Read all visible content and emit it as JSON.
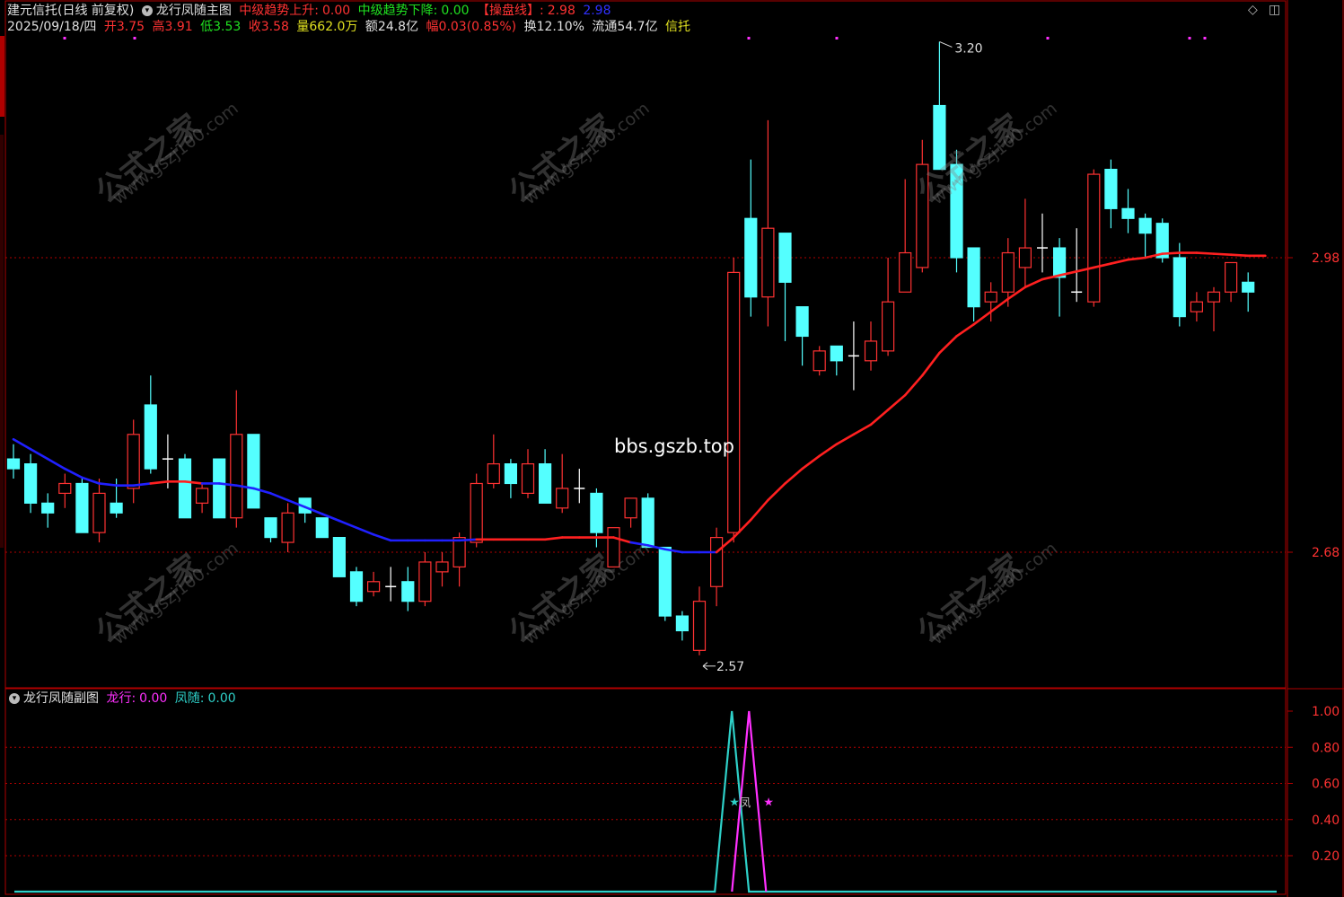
{
  "header": {
    "stock_name": "建元信托",
    "mode": "(日线 前复权)",
    "indicator_name": "龙行凤随主图",
    "up_label": "中级趋势上升",
    "up_value": "0.00",
    "down_label": "中级趋势下降",
    "down_value": "0.00",
    "op_label": "【操盘线】",
    "op_value": "2.98",
    "op_value2": "2.98"
  },
  "quote": {
    "date": "2025/09/18/四",
    "open_label": "开",
    "open": "3.75",
    "high_label": "高",
    "high": "3.91",
    "low_label": "低",
    "low": "3.53",
    "close_label": "收",
    "close": "3.58",
    "vol_label": "量",
    "vol": "662.0万",
    "amt_label": "额",
    "amt": "24.8亿",
    "chg_label": "幅",
    "chg": "0.03(0.85%)",
    "turn_label": "换",
    "turn": "12.10%",
    "float_label": "流通",
    "float": "54.7亿",
    "sector": "信托"
  },
  "sub": {
    "name": "龙行凤随副图",
    "long_label": "龙行",
    "long_value": "0.00",
    "feng_label": "凤随",
    "feng_value": "0.00",
    "marker_text": "凤"
  },
  "watermark": {
    "text": "公式之家",
    "url": "www.gszj100.com"
  },
  "overlay_text": "bbs.gszb.top",
  "annotations": {
    "high": "3.20",
    "low": "2.57"
  },
  "colors": {
    "up": "#ff3232",
    "down": "#54ffff",
    "doji": "#ffffff",
    "ma_up": "#ff2020",
    "ma_down": "#2020ff",
    "frame": "#b00000",
    "long_line": "#ff30ff",
    "feng_line": "#2ed0c8"
  },
  "chart_data": [
    {
      "type": "candlestick",
      "price_ticks": [
        2.68,
        2.98
      ],
      "ylim": [
        2.54,
        3.22
      ],
      "candles": [
        {
          "o": 2.775,
          "c": 2.765,
          "h": 2.79,
          "l": 2.755
        },
        {
          "o": 2.77,
          "c": 2.73,
          "h": 2.78,
          "l": 2.72
        },
        {
          "o": 2.73,
          "c": 2.72,
          "h": 2.74,
          "l": 2.705
        },
        {
          "o": 2.74,
          "c": 2.75,
          "h": 2.76,
          "l": 2.725
        },
        {
          "o": 2.75,
          "c": 2.7,
          "h": 2.755,
          "l": 2.7
        },
        {
          "o": 2.7,
          "c": 2.74,
          "h": 2.755,
          "l": 2.69
        },
        {
          "o": 2.73,
          "c": 2.72,
          "h": 2.755,
          "l": 2.715
        },
        {
          "o": 2.745,
          "c": 2.8,
          "h": 2.815,
          "l": 2.73
        },
        {
          "o": 2.83,
          "c": 2.765,
          "h": 2.86,
          "l": 2.76
        },
        {
          "o": 2.775,
          "c": 2.775,
          "h": 2.8,
          "l": 2.745
        },
        {
          "o": 2.775,
          "c": 2.715,
          "h": 2.78,
          "l": 2.715
        },
        {
          "o": 2.73,
          "c": 2.745,
          "h": 2.75,
          "l": 2.72
        },
        {
          "o": 2.775,
          "c": 2.715,
          "h": 2.775,
          "l": 2.72
        },
        {
          "o": 2.715,
          "c": 2.8,
          "h": 2.845,
          "l": 2.705
        },
        {
          "o": 2.8,
          "c": 2.725,
          "h": 2.8,
          "l": 2.725
        },
        {
          "o": 2.715,
          "c": 2.695,
          "h": 2.715,
          "l": 2.69
        },
        {
          "o": 2.69,
          "c": 2.72,
          "h": 2.73,
          "l": 2.68
        },
        {
          "o": 2.735,
          "c": 2.72,
          "h": 2.735,
          "l": 2.71
        },
        {
          "o": 2.715,
          "c": 2.695,
          "h": 2.715,
          "l": 2.695
        },
        {
          "o": 2.695,
          "c": 2.655,
          "h": 2.695,
          "l": 2.655
        },
        {
          "o": 2.66,
          "c": 2.63,
          "h": 2.665,
          "l": 2.625
        },
        {
          "o": 2.64,
          "c": 2.65,
          "h": 2.66,
          "l": 2.635
        },
        {
          "o": 2.645,
          "c": 2.645,
          "h": 2.665,
          "l": 2.63
        },
        {
          "o": 2.65,
          "c": 2.63,
          "h": 2.665,
          "l": 2.62
        },
        {
          "o": 2.63,
          "c": 2.67,
          "h": 2.68,
          "l": 2.625
        },
        {
          "o": 2.66,
          "c": 2.67,
          "h": 2.68,
          "l": 2.645
        },
        {
          "o": 2.665,
          "c": 2.695,
          "h": 2.7,
          "l": 2.645
        },
        {
          "o": 2.69,
          "c": 2.75,
          "h": 2.76,
          "l": 2.685
        },
        {
          "o": 2.75,
          "c": 2.77,
          "h": 2.8,
          "l": 2.745
        },
        {
          "o": 2.77,
          "c": 2.75,
          "h": 2.775,
          "l": 2.735
        },
        {
          "o": 2.74,
          "c": 2.77,
          "h": 2.785,
          "l": 2.735
        },
        {
          "o": 2.77,
          "c": 2.73,
          "h": 2.785,
          "l": 2.73
        },
        {
          "o": 2.725,
          "c": 2.745,
          "h": 2.78,
          "l": 2.72
        },
        {
          "o": 2.745,
          "c": 2.745,
          "h": 2.765,
          "l": 2.73
        },
        {
          "o": 2.74,
          "c": 2.7,
          "h": 2.745,
          "l": 2.685
        },
        {
          "o": 2.665,
          "c": 2.705,
          "h": 2.705,
          "l": 2.665
        },
        {
          "o": 2.715,
          "c": 2.735,
          "h": 2.735,
          "l": 2.705
        },
        {
          "o": 2.735,
          "c": 2.685,
          "h": 2.74,
          "l": 2.685
        },
        {
          "o": 2.685,
          "c": 2.615,
          "h": 2.685,
          "l": 2.61
        },
        {
          "o": 2.615,
          "c": 2.6,
          "h": 2.62,
          "l": 2.59
        },
        {
          "o": 2.58,
          "c": 2.63,
          "h": 2.645,
          "l": 2.575
        },
        {
          "o": 2.645,
          "c": 2.695,
          "h": 2.705,
          "l": 2.625
        },
        {
          "o": 2.7,
          "c": 2.965,
          "h": 2.98,
          "l": 2.69
        },
        {
          "o": 3.02,
          "c": 2.94,
          "h": 3.08,
          "l": 2.92
        },
        {
          "o": 2.94,
          "c": 3.01,
          "h": 3.12,
          "l": 2.91
        },
        {
          "o": 3.005,
          "c": 2.955,
          "h": 3.005,
          "l": 2.895
        },
        {
          "o": 2.93,
          "c": 2.9,
          "h": 2.93,
          "l": 2.87
        },
        {
          "o": 2.865,
          "c": 2.885,
          "h": 2.89,
          "l": 2.86
        },
        {
          "o": 2.89,
          "c": 2.875,
          "h": 2.89,
          "l": 2.86
        },
        {
          "o": 2.88,
          "c": 2.88,
          "h": 2.915,
          "l": 2.845
        },
        {
          "o": 2.875,
          "c": 2.895,
          "h": 2.915,
          "l": 2.865
        },
        {
          "o": 2.885,
          "c": 2.935,
          "h": 2.98,
          "l": 2.88
        },
        {
          "o": 2.945,
          "c": 2.985,
          "h": 3.06,
          "l": 2.945
        },
        {
          "o": 2.97,
          "c": 3.075,
          "h": 3.1,
          "l": 2.965
        },
        {
          "o": 3.135,
          "c": 3.07,
          "h": 3.2,
          "l": 3.07
        },
        {
          "o": 3.075,
          "c": 2.98,
          "h": 3.09,
          "l": 2.965
        },
        {
          "o": 2.99,
          "c": 2.93,
          "h": 2.99,
          "l": 2.915
        },
        {
          "o": 2.935,
          "c": 2.945,
          "h": 2.955,
          "l": 2.915
        },
        {
          "o": 2.945,
          "c": 2.985,
          "h": 3.0,
          "l": 2.93
        },
        {
          "o": 2.97,
          "c": 2.99,
          "h": 3.04,
          "l": 2.95
        },
        {
          "o": 2.99,
          "c": 2.99,
          "h": 3.025,
          "l": 2.965
        },
        {
          "o": 2.99,
          "c": 2.96,
          "h": 3.0,
          "l": 2.92
        },
        {
          "o": 2.945,
          "c": 2.945,
          "h": 3.01,
          "l": 2.935
        },
        {
          "o": 2.935,
          "c": 3.065,
          "h": 3.07,
          "l": 2.93
        },
        {
          "o": 3.07,
          "c": 3.03,
          "h": 3.08,
          "l": 3.01
        },
        {
          "o": 3.03,
          "c": 3.02,
          "h": 3.05,
          "l": 3.005
        },
        {
          "o": 3.02,
          "c": 3.005,
          "h": 3.025,
          "l": 2.98
        },
        {
          "o": 3.015,
          "c": 2.98,
          "h": 3.02,
          "l": 2.975
        },
        {
          "o": 2.98,
          "c": 2.92,
          "h": 2.995,
          "l": 2.91
        },
        {
          "o": 2.925,
          "c": 2.935,
          "h": 2.945,
          "l": 2.915
        },
        {
          "o": 2.935,
          "c": 2.945,
          "h": 2.95,
          "l": 2.905
        },
        {
          "o": 2.945,
          "c": 2.975,
          "h": 2.975,
          "l": 2.935
        },
        {
          "o": 2.955,
          "c": 2.945,
          "h": 2.965,
          "l": 2.925
        }
      ],
      "ma": [
        2.795,
        2.785,
        2.775,
        2.765,
        2.756,
        2.75,
        2.748,
        2.748,
        2.75,
        2.752,
        2.752,
        2.75,
        2.75,
        2.748,
        2.745,
        2.74,
        2.733,
        2.726,
        2.719,
        2.712,
        2.705,
        2.698,
        2.692,
        2.692,
        2.692,
        2.692,
        2.692,
        2.693,
        2.693,
        2.693,
        2.693,
        2.693,
        2.695,
        2.695,
        2.695,
        2.695,
        2.69,
        2.687,
        2.683,
        2.68,
        2.68,
        2.68,
        2.695,
        2.713,
        2.733,
        2.75,
        2.765,
        2.778,
        2.79,
        2.8,
        2.81,
        2.825,
        2.84,
        2.86,
        2.883,
        2.9,
        2.912,
        2.925,
        2.938,
        2.95,
        2.958,
        2.962,
        2.966,
        2.97,
        2.974,
        2.978,
        2.98,
        2.984,
        2.985,
        2.985,
        2.984,
        2.983,
        2.982,
        2.982
      ],
      "ma_down_segments": [
        [
          0,
          7
        ],
        [
          7,
          8
        ],
        [
          11,
          27
        ],
        [
          36,
          41
        ]
      ]
    },
    {
      "type": "line",
      "yticks": [
        0.2,
        0.4,
        0.6,
        0.8,
        1.0
      ],
      "ylim": [
        0,
        1.05
      ],
      "series": [
        {
          "name": "龙行",
          "peak_index": 43,
          "value": 1.0
        },
        {
          "name": "凤随",
          "peak_index": 42,
          "value": 1.0
        }
      ]
    }
  ]
}
